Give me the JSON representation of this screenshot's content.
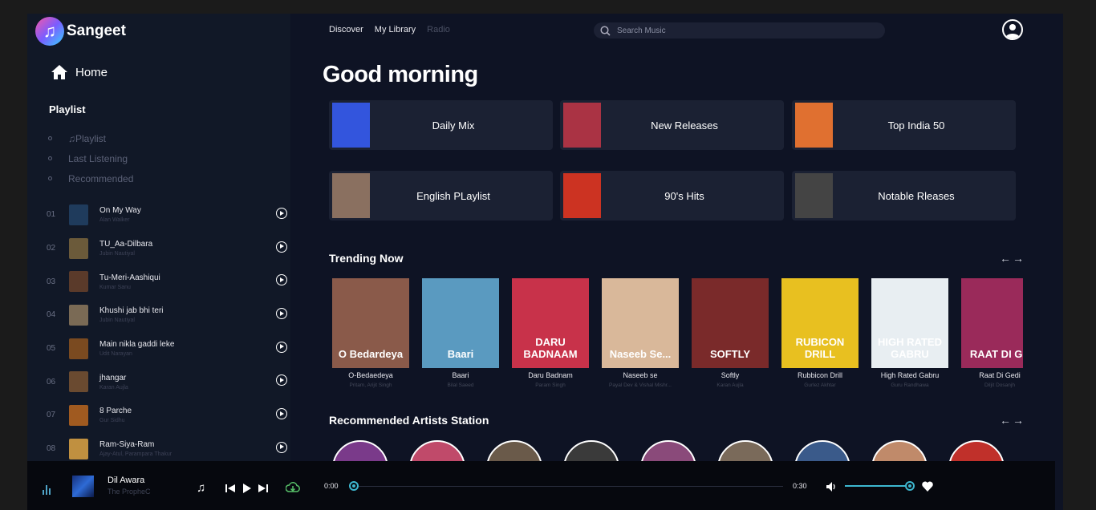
{
  "app": {
    "name": "Sangeet"
  },
  "sidebar": {
    "home_label": "Home",
    "playlist_heading": "Playlist",
    "links": [
      {
        "label": "Playlist",
        "icon": "music-note-icon"
      },
      {
        "label": "Last Listening"
      },
      {
        "label": "Recommended"
      }
    ],
    "tracks": [
      {
        "num": "01",
        "name": "On My Way",
        "artist": "Alan Walker",
        "color": "#1f3b5c"
      },
      {
        "num": "02",
        "name": "TU_Aa-Dilbara",
        "artist": "Jubin Nautiyal",
        "color": "#6b5a3a"
      },
      {
        "num": "03",
        "name": "Tu-Meri-Aashiqui",
        "artist": "Kumar Sanu",
        "color": "#5a3a2a"
      },
      {
        "num": "04",
        "name": "Khushi jab bhi teri",
        "artist": "Jubin Nautiyal",
        "color": "#7a6a55"
      },
      {
        "num": "05",
        "name": "Main nikla gaddi leke",
        "artist": "Udit Narayan",
        "color": "#7a4a20"
      },
      {
        "num": "06",
        "name": "jhangar",
        "artist": "Karan Aujla",
        "color": "#6a4a30"
      },
      {
        "num": "07",
        "name": "8 Parche",
        "artist": "Gur Sidhu",
        "color": "#a05a20"
      },
      {
        "num": "08",
        "name": "Ram-Siya-Ram",
        "artist": "Ajay-Atul, Parampara Thakur",
        "color": "#c09040"
      }
    ]
  },
  "nav": {
    "items": [
      {
        "label": "Discover",
        "muted": false
      },
      {
        "label": "My Library",
        "muted": false
      },
      {
        "label": "Radio",
        "muted": true
      }
    ],
    "search_placeholder": "Search Music"
  },
  "main": {
    "greeting": "Good morning",
    "quick": [
      {
        "label": "Daily Mix",
        "color": "#3355dd"
      },
      {
        "label": "New Releases",
        "color": "#aa3344"
      },
      {
        "label": "Top India 50",
        "color": "#e07030"
      },
      {
        "label": "English PLaylist",
        "color": "#8a7060"
      },
      {
        "label": "90's Hits",
        "color": "#cc3322"
      },
      {
        "label": "Notable Rleases",
        "color": "#444444"
      }
    ],
    "trending_title": "Trending Now",
    "trending": [
      {
        "name": "O-Bedaedeya",
        "artist": "Pritam, Arijit Singh",
        "cover_text": "O Bedardeya",
        "color": "#8a5a4a"
      },
      {
        "name": "Baari",
        "artist": "Bilal Saeed",
        "cover_text": "Baari",
        "color": "#5a9ac0"
      },
      {
        "name": "Daru Badnam",
        "artist": "Param Singh",
        "cover_text": "DARU BADNAAM",
        "color": "#c8324a"
      },
      {
        "name": "Naseeb se",
        "artist": "Payal Dev & Vishal Mishr...",
        "cover_text": "Naseeb Se...",
        "color": "#d9b89a"
      },
      {
        "name": "Softly",
        "artist": "Karan Aujla",
        "cover_text": "SOFTLY",
        "color": "#7a2a2a"
      },
      {
        "name": "Rubbicon Drill",
        "artist": "Gurlez Akhtar",
        "cover_text": "RUBICON DRILL",
        "color": "#e8c020"
      },
      {
        "name": "High Rated Gabru",
        "artist": "Guru Randhawa",
        "cover_text": "HIGH RATED GABRU",
        "color": "#e8eef2"
      },
      {
        "name": "Raat Di Gedi",
        "artist": "Diljit Dosanjh",
        "cover_text": "RAAT DI GE",
        "color": "#9a2a5a"
      }
    ],
    "artists_title": "Recommended Artists Station",
    "artists": [
      "#7a3a8a",
      "#c04a6a",
      "#6a5a4a",
      "#3a3a3a",
      "#8a4a7a",
      "#7a6a5a",
      "#3a5a8a",
      "#c08a6a",
      "#c0302a"
    ]
  },
  "player": {
    "title": "Dil Awara",
    "artist": "The PropheC",
    "elapsed": "0:00",
    "duration": "0:30",
    "progress": 0,
    "volume": 1
  }
}
